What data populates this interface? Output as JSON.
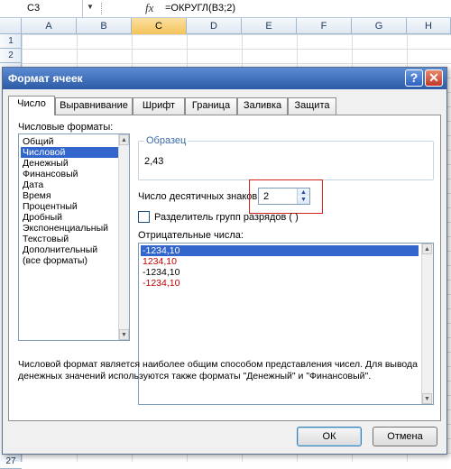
{
  "formula_bar": {
    "cell_ref": "C3",
    "fx_symbol": "fx",
    "formula": "=ОКРУГЛ(B3;2)",
    "dropdown_glyph": "▼"
  },
  "sheet": {
    "columns": [
      "A",
      "B",
      "C",
      "D",
      "E",
      "F",
      "G",
      "H"
    ],
    "active_column": "C",
    "visible_rows": [
      "1",
      "2",
      "27"
    ]
  },
  "dialog": {
    "title": "Формат ячеек",
    "help_glyph": "?",
    "close_glyph": "✕",
    "tabs": [
      "Число",
      "Выравнивание",
      "Шрифт",
      "Граница",
      "Заливка",
      "Защита"
    ],
    "active_tab": "Число",
    "formats_label": "Числовые форматы:",
    "formats": [
      "Общий",
      "Числовой",
      "Денежный",
      "Финансовый",
      "Дата",
      "Время",
      "Процентный",
      "Дробный",
      "Экспоненциальный",
      "Текстовый",
      "Дополнительный",
      "(все форматы)"
    ],
    "selected_format": "Числовой",
    "sample_caption": "Образец",
    "sample_value": "2,43",
    "decimals_label": "Число десятичных знаков:",
    "decimals_value": "2",
    "separator_label": "Разделитель групп разрядов ( )",
    "separator_checked": false,
    "negative_label": "Отрицательные числа:",
    "negative_numbers": [
      {
        "text": "-1234,10",
        "color": "#000000",
        "selected": true
      },
      {
        "text": "1234,10",
        "color": "#c00000",
        "selected": false
      },
      {
        "text": "-1234,10",
        "color": "#000000",
        "selected": false
      },
      {
        "text": "-1234,10",
        "color": "#c00000",
        "selected": false
      }
    ],
    "description": "Числовой формат является наиболее общим способом представления чисел. Для вывода денежных значений используются также форматы \"Денежный\" и \"Финансовый\".",
    "ok_label": "ОК",
    "cancel_label": "Отмена",
    "scroll_up_glyph": "▲",
    "scroll_down_glyph": "▼",
    "highlight_color": "#d3221e"
  }
}
